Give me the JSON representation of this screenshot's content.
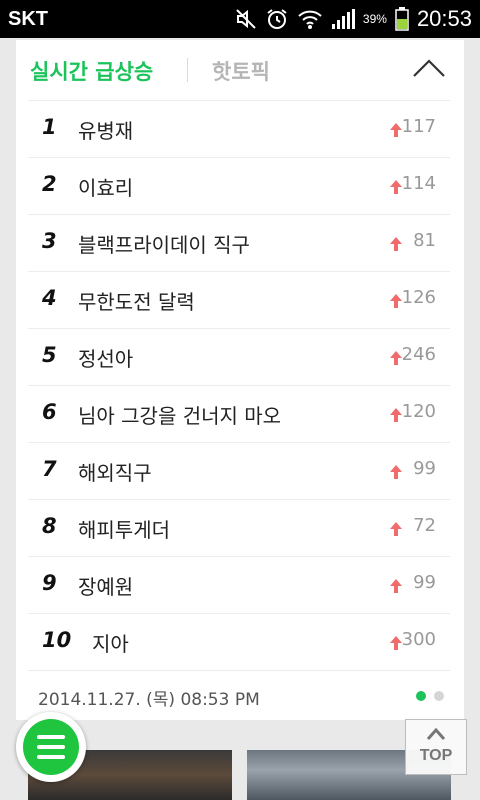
{
  "status_bar": {
    "carrier": "SKT",
    "battery_percent": "39%",
    "time": "20:53",
    "icons": [
      "mute-icon",
      "alarm-icon",
      "wifi-icon",
      "signal-icon",
      "battery-icon"
    ]
  },
  "tabs": {
    "active": "실시간 급상승",
    "inactive": "핫토픽"
  },
  "trending": [
    {
      "rank": "1",
      "term": "유병재",
      "count": "117"
    },
    {
      "rank": "2",
      "term": "이효리",
      "count": "114"
    },
    {
      "rank": "3",
      "term": "블랙프라이데이 직구",
      "count": "81"
    },
    {
      "rank": "4",
      "term": "무한도전 달력",
      "count": "126"
    },
    {
      "rank": "5",
      "term": "정선아",
      "count": "246"
    },
    {
      "rank": "6",
      "term": "님아 그강을 건너지 마오",
      "count": "120"
    },
    {
      "rank": "7",
      "term": "해외직구",
      "count": "99"
    },
    {
      "rank": "8",
      "term": "해피투게더",
      "count": "72"
    },
    {
      "rank": "9",
      "term": "장예원",
      "count": "99"
    },
    {
      "rank": "10",
      "term": "지아",
      "count": "300"
    }
  ],
  "timestamp": "2014.11.27. (목) 08:53 PM",
  "pager": {
    "pages": 2,
    "current": 1
  },
  "top_button": {
    "label": "TOP"
  },
  "colors": {
    "accent": "#1cc35a",
    "arrow_up": "#f06b6b",
    "menu_button": "#20c53f"
  }
}
